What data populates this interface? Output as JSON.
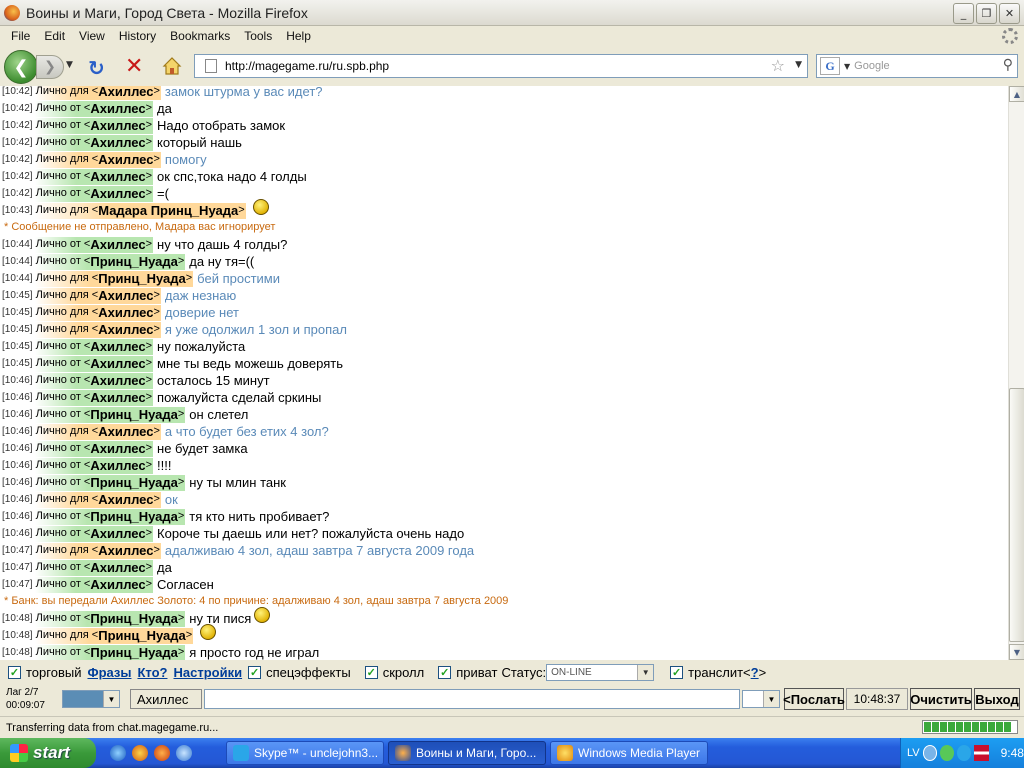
{
  "window": {
    "title": "Воины и Маги, Город Света - Mozilla Firefox",
    "min_label": "_",
    "max_label": "❐",
    "close_label": "✕"
  },
  "menu": [
    "File",
    "Edit",
    "View",
    "History",
    "Bookmarks",
    "Tools",
    "Help"
  ],
  "nav": {
    "url": "http://magegame.ru/ru.spb.php",
    "search_placeholder": "Google",
    "search_engine_glyph": "G"
  },
  "chat": [
    {
      "ts": "[10:42]",
      "dir": "to",
      "prefix": "Лично для <",
      "nick": "Ахиллес",
      "msg": "замок штурма у вас идет?"
    },
    {
      "ts": "[10:42]",
      "dir": "from",
      "prefix": "Лично от <",
      "nick": "Ахиллес",
      "msg": "да"
    },
    {
      "ts": "[10:42]",
      "dir": "from",
      "prefix": "Лично от <",
      "nick": "Ахиллес",
      "msg": "Надо отобрать замок"
    },
    {
      "ts": "[10:42]",
      "dir": "from",
      "prefix": "Лично от <",
      "nick": "Ахиллес",
      "msg": "который нашь"
    },
    {
      "ts": "[10:42]",
      "dir": "to",
      "prefix": "Лично для <",
      "nick": "Ахиллес",
      "msg": "помогу"
    },
    {
      "ts": "[10:42]",
      "dir": "from",
      "prefix": "Лично от <",
      "nick": "Ахиллес",
      "msg": "ок спс,тока надо 4 голды"
    },
    {
      "ts": "[10:42]",
      "dir": "from",
      "prefix": "Лично от <",
      "nick": "Ахиллес",
      "msg": "=("
    },
    {
      "ts": "[10:43]",
      "dir": "to",
      "prefix": "Лично для <",
      "nick": "Мадара Принц_Нуада",
      "msg": "",
      "smile": true
    },
    {
      "sys": "* Сообщение не отправлено, Мадара вас игнорирует"
    },
    {
      "ts": "[10:44]",
      "dir": "from",
      "prefix": "Лично от <",
      "nick": "Ахиллес",
      "msg": "ну что дашь 4 голды?"
    },
    {
      "ts": "[10:44]",
      "dir": "from",
      "prefix": "Лично от <",
      "nick": "Принц_Нуада",
      "msg": "да ну тя=(("
    },
    {
      "ts": "[10:44]",
      "dir": "to",
      "prefix": "Лично для <",
      "nick": "Принц_Нуада",
      "msg": "бей простими"
    },
    {
      "ts": "[10:45]",
      "dir": "to",
      "prefix": "Лично для <",
      "nick": "Ахиллес",
      "msg": "даж незнаю"
    },
    {
      "ts": "[10:45]",
      "dir": "to",
      "prefix": "Лично для <",
      "nick": "Ахиллес",
      "msg": "доверие нет"
    },
    {
      "ts": "[10:45]",
      "dir": "to",
      "prefix": "Лично для <",
      "nick": "Ахиллес",
      "msg": "я уже одолжил 1 зол и пропал"
    },
    {
      "ts": "[10:45]",
      "dir": "from",
      "prefix": "Лично от <",
      "nick": "Ахиллес",
      "msg": "ну пожалуйста"
    },
    {
      "ts": "[10:45]",
      "dir": "from",
      "prefix": "Лично от <",
      "nick": "Ахиллес",
      "msg": "мне ты ведь можешь доверять"
    },
    {
      "ts": "[10:46]",
      "dir": "from",
      "prefix": "Лично от <",
      "nick": "Ахиллес",
      "msg": "осталось 15 минут"
    },
    {
      "ts": "[10:46]",
      "dir": "from",
      "prefix": "Лично от <",
      "nick": "Ахиллес",
      "msg": "пожалуйста сделай сркины"
    },
    {
      "ts": "[10:46]",
      "dir": "from",
      "prefix": "Лично от <",
      "nick": "Принц_Нуада",
      "msg": "он слетел"
    },
    {
      "ts": "[10:46]",
      "dir": "to",
      "prefix": "Лично для <",
      "nick": "Ахиллес",
      "msg": "а что будет без етих 4 зол?"
    },
    {
      "ts": "[10:46]",
      "dir": "from",
      "prefix": "Лично от <",
      "nick": "Ахиллес",
      "msg": "не будет замка"
    },
    {
      "ts": "[10:46]",
      "dir": "from",
      "prefix": "Лично от <",
      "nick": "Ахиллес",
      "msg": "!!!!"
    },
    {
      "ts": "[10:46]",
      "dir": "from",
      "prefix": "Лично от <",
      "nick": "Принц_Нуада",
      "msg": "ну ты млин танк"
    },
    {
      "ts": "[10:46]",
      "dir": "to",
      "prefix": "Лично для <",
      "nick": "Ахиллес",
      "msg": "ок"
    },
    {
      "ts": "[10:46]",
      "dir": "from",
      "prefix": "Лично от <",
      "nick": "Принц_Нуада",
      "msg": "тя кто нить пробивает?"
    },
    {
      "ts": "[10:46]",
      "dir": "from",
      "prefix": "Лично от <",
      "nick": "Ахиллес",
      "msg": "Короче ты даешь или нет? пожалуйста очень надо"
    },
    {
      "ts": "[10:47]",
      "dir": "to",
      "prefix": "Лично для <",
      "nick": "Ахиллес",
      "msg": "адалживаю 4 зол, адаш завтра 7 августа 2009 года"
    },
    {
      "ts": "[10:47]",
      "dir": "from",
      "prefix": "Лично от <",
      "nick": "Ахиллес",
      "msg": "да"
    },
    {
      "ts": "[10:47]",
      "dir": "from",
      "prefix": "Лично от <",
      "nick": "Ахиллес",
      "msg": "Согласен"
    },
    {
      "sys": "* Банк: вы передали Ахиллес Золото: 4 по причине: адалживаю 4 зол, адаш завтра 7 августа 2009"
    },
    {
      "ts": "[10:48]",
      "dir": "from",
      "prefix": "Лично от <",
      "nick": "Принц_Нуада",
      "msg": "ну ти пися",
      "smile": true
    },
    {
      "ts": "[10:48]",
      "dir": "to",
      "prefix": "Лично для <",
      "nick": "Принц_Нуада",
      "msg": "",
      "smile": true
    },
    {
      "ts": "[10:48]",
      "dir": "from",
      "prefix": "Лично от <",
      "nick": "Принц_Нуада",
      "msg": "я просто год не играл"
    }
  ],
  "panel": {
    "trade_label": "торговый",
    "phrases_link": "Фразы",
    "who_link": "Кто?",
    "settings_link": "Настройки",
    "effects_label": "спецэффекты",
    "scroll_label": "скролл",
    "private_label": "приват",
    "status_label": "Статус:",
    "status_value": "ON-LINE",
    "translit_label": "транслит<",
    "translit_help": "?",
    "translit_close": ">",
    "lag_label": "Лаг 2/7",
    "lag_time": "00:09:07",
    "nick": "Ахиллес",
    "message_value": "",
    "send_button": "<Послать",
    "clock": "10:48:37",
    "clear_button": "Очистить",
    "exit_button": "Выход"
  },
  "status_bar": {
    "text": "Transferring data from chat.magegame.ru...",
    "progress": 1.0
  },
  "taskbar": {
    "start_label": "start",
    "tasks": [
      {
        "label": "Skype™ - unclejohn3...",
        "active": false
      },
      {
        "label": "Воины и Маги, Горо...",
        "active": true
      },
      {
        "label": "Windows Media Player",
        "active": false
      }
    ],
    "lang": "LV",
    "time": "9:48"
  },
  "colors": {
    "from_tag": "#b8e6b0",
    "to_tag": "#ffd89a",
    "outgoing_msg": "#5a8ab8",
    "system_msg": "#c86a10",
    "link": "#003d99"
  }
}
